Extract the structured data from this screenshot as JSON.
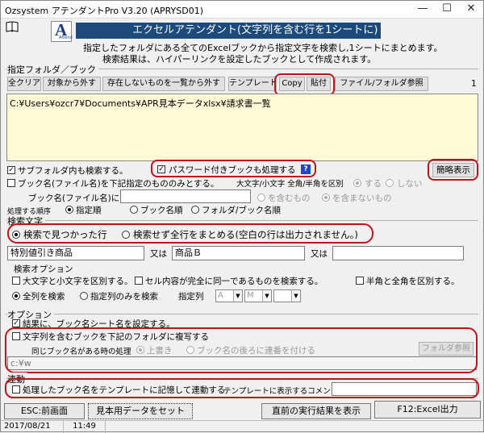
{
  "window": {
    "title": "Ozsystem アテンダントPro V3.20 (APRYSD01)",
    "minimize": "—",
    "maximize": "☐",
    "close": "✕"
  },
  "header": {
    "book_icon": "book-icon",
    "logo_letter": "A",
    "logo_sub": "Attend",
    "banner_title": "エクセルアテンダント(文字列を含む行を1シートに)",
    "desc_line1": "指定したフォルダにある全てのExcelブックから指定文字を検索し,1シートにまとめます。",
    "desc_line2": "検索結果は、ハイパーリンクを設定したブックとして作成されます。"
  },
  "folder_group": {
    "title": "指定フォルダ／ブック",
    "buttons": {
      "clear_all": "全クリア",
      "remove_from_target": "対象から外す",
      "remove_missing": "存在しないものを一覧から外す",
      "template": "テンプレート",
      "copy": "Copy",
      "paste": "貼付",
      "browse": "ファイル/フォルダ参照"
    },
    "count": "1",
    "list_items": [
      "C:¥Users¥ozcr7¥Documents¥APR見本データxlsx¥請求書一覧"
    ]
  },
  "options_top": {
    "search_subfolders": "サブフォルダ内も検索する。",
    "password_books": "パスワード付きブックも処理する",
    "help_badge": "?",
    "simple_view": "簡略表示",
    "book_name_filter": "ブック名(ファイル名)を下記指定のもののみとする。",
    "case_width_label": "大文字/小文字 全角/半角を区別",
    "yes": "する",
    "no": "しない",
    "book_name_label": "ブック名(ファイル名)に",
    "book_name_value": "",
    "contains": "を含むもの",
    "not_contains": "を含まないもの",
    "order_label": "処理する順序",
    "order_specified": "指定順",
    "order_book": "ブック名順",
    "order_folder_book": "フォルダ/ブック名順"
  },
  "search_group": {
    "title": "検索文字",
    "mode_found_rows": "検索で見つかった行",
    "mode_all_rows": "検索せず全行をまとめる(空白の行は出力されません。)",
    "term1": "特別値引き商品",
    "or1": "又は",
    "term2": "商品Ｂ",
    "or2": "又は",
    "term3": ""
  },
  "search_options": {
    "title": "検索オプション",
    "case_sensitive": "大文字と小文字を区別する。",
    "exact_match": "セル内容が完全に同一であるものを検索する。",
    "width_sensitive": "半角と全角を区別する。",
    "all_columns": "全列を検索",
    "specified_columns": "指定列のみを検索",
    "column_label": "指定列",
    "col1": "A",
    "col2": "M",
    "col3": ""
  },
  "option_group": {
    "title": "オプション",
    "set_book_sheet_name": "結果に、ブック名シート名を設定する。",
    "copy_books": "文字列を含むブックを下記のフォルダに複写する",
    "same_name_label": "同じブック名がある時の処理",
    "overwrite": "上書き",
    "append_number": "ブック名の後ろに連番を付ける",
    "folder_browse": "フォルダ参照",
    "copy_folder": "c:¥w"
  },
  "link_group": {
    "title": "連動",
    "remember_template": "処理したブック名をテンプレートに記憶して連動する",
    "comment_label": "テンプレートに表示するコメント",
    "comment_value": ""
  },
  "bottom_buttons": {
    "esc": "ESC:前画面",
    "sample_data": "見本用データをセット",
    "last_result": "直前の実行結果を表示",
    "f12": "F12:Excel出力"
  },
  "status": {
    "date": "2017/08/21",
    "time": "11:49"
  }
}
